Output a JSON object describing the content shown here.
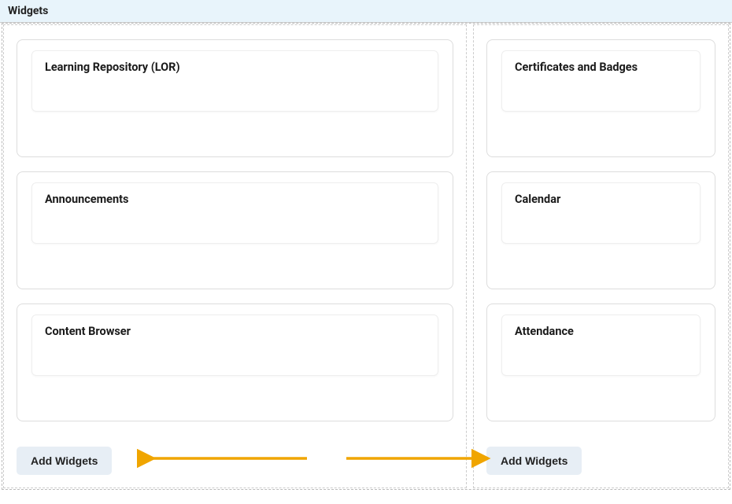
{
  "section_title": "Widgets",
  "columns": [
    {
      "widgets": [
        {
          "title": "Learning Repository (LOR)"
        },
        {
          "title": "Announcements"
        },
        {
          "title": "Content Browser"
        }
      ],
      "add_button_label": "Add Widgets"
    },
    {
      "widgets": [
        {
          "title": "Certificates and Badges"
        },
        {
          "title": "Calendar"
        },
        {
          "title": "Attendance"
        }
      ],
      "add_button_label": "Add Widgets"
    }
  ],
  "annotation": {
    "arrow_color": "#f0a500"
  }
}
